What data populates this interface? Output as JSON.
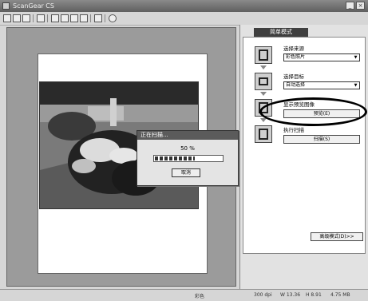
{
  "window": {
    "title": "ScanGear CS"
  },
  "dialog": {
    "title": "正在扫描...",
    "percent": "50 %",
    "progress": 0.6,
    "cancel_label": "取消"
  },
  "panel": {
    "tab_label": "简单模式",
    "step1": {
      "label": "选择来源",
      "value": "彩色照片"
    },
    "step2": {
      "label": "选择目标",
      "value": "自动选择"
    },
    "step3": {
      "label": "显示预览图像",
      "button": "预览(E)"
    },
    "step4": {
      "label": "执行扫描",
      "button": "扫描(S)"
    },
    "advanced_button": "高级模式(D)>>"
  },
  "status": {
    "mode": "彩色",
    "dpi": "300 dpi",
    "w": "W 13.36",
    "h": "H 8.91",
    "size": "4.75 MB"
  }
}
